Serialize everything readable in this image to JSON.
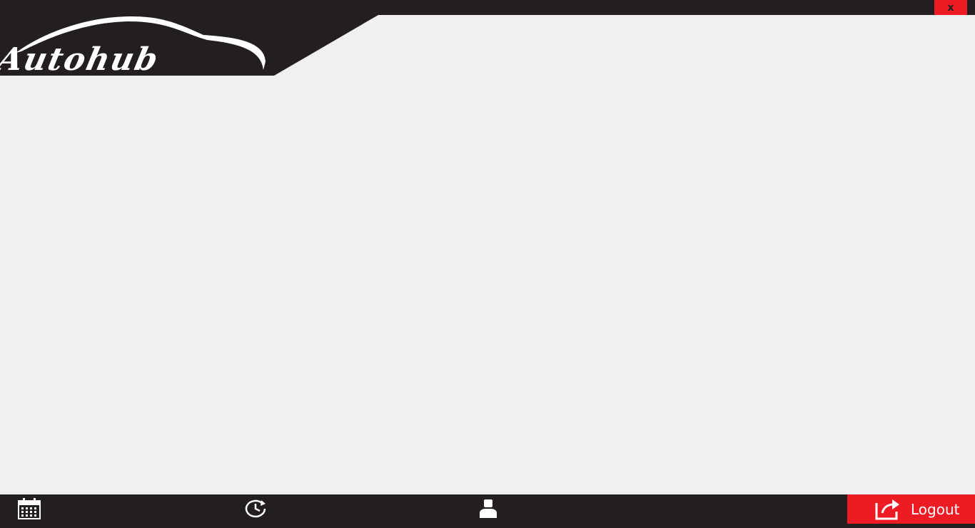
{
  "app": {
    "brand": "Autohub",
    "window_close_label": "x"
  },
  "footer": {
    "items": [
      {
        "icon": "calendar-icon"
      },
      {
        "icon": "history-icon"
      },
      {
        "icon": "user-icon"
      }
    ],
    "logout_label": "Logout",
    "logout_icon": "logout-icon"
  },
  "colors": {
    "bar": "#231f20",
    "accent": "#ed1c24",
    "background": "#f0f0f0"
  }
}
